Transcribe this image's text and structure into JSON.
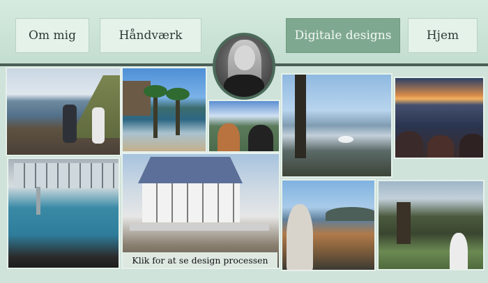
{
  "nav": {
    "about": "Om mig",
    "craft": "Håndværk",
    "digital": "Digitale designs",
    "home": "Hjem"
  },
  "avatar": {
    "alt": "Profilbillede"
  },
  "caption": "Klik for at se design processen",
  "photos": [
    {
      "name": "photo-beach-rocks"
    },
    {
      "name": "photo-palm-harbor"
    },
    {
      "name": "photo-mountain-view"
    },
    {
      "name": "photo-lake-tree"
    },
    {
      "name": "photo-sunset-sea"
    },
    {
      "name": "photo-spa-pool"
    },
    {
      "name": "photo-glass-pavilion"
    },
    {
      "name": "photo-coast-town"
    },
    {
      "name": "photo-oak-tree"
    }
  ],
  "colors": {
    "accent": "#7fa890",
    "background": "#cfe3da",
    "divider": "#4b5f57"
  }
}
